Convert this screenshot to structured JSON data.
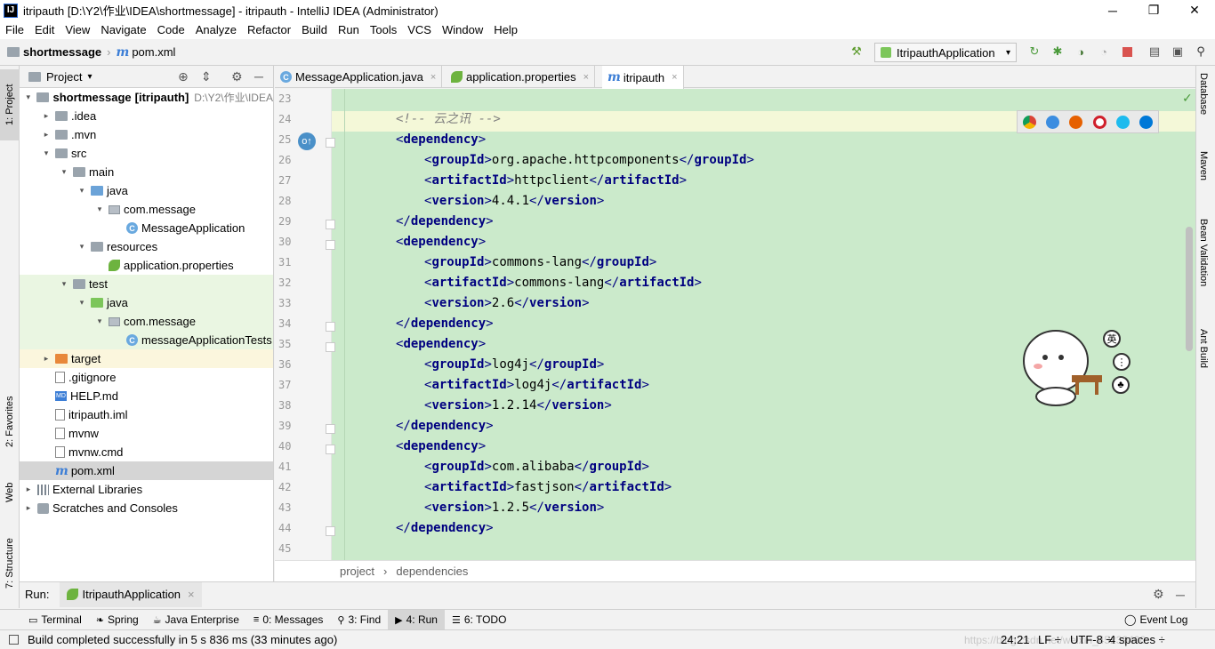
{
  "window": {
    "title": "itripauth [D:\\Y2\\作业\\IDEA\\shortmessage] - itripauth - IntelliJ IDEA (Administrator)",
    "app_icon_text": "IJ",
    "minimize": "─",
    "maximize": "❐",
    "close": "✕"
  },
  "menu": [
    "File",
    "Edit",
    "View",
    "Navigate",
    "Code",
    "Analyze",
    "Refactor",
    "Build",
    "Run",
    "Tools",
    "VCS",
    "Window",
    "Help"
  ],
  "navbar": {
    "project": "shortmessage",
    "sep": "›",
    "file": "pom.xml",
    "run_config": "ItripauthApplication"
  },
  "left_stripe": {
    "project": "1: Project",
    "favorites": "2: Favorites",
    "web": "Web",
    "structure": "7: Structure"
  },
  "project_panel": {
    "header": "Project",
    "header_arrow": "▾",
    "tree": [
      {
        "label": "shortmessage",
        "module": "[itripauth]",
        "path": "D:\\Y2\\作业\\IDEA"
      },
      {
        "label": ".idea"
      },
      {
        "label": ".mvn"
      },
      {
        "label": "src"
      },
      {
        "label": "main"
      },
      {
        "label": "java"
      },
      {
        "label": "com.message"
      },
      {
        "label": "MessageApplication"
      },
      {
        "label": "resources"
      },
      {
        "label": "application.properties"
      },
      {
        "label": "test"
      },
      {
        "label": "java"
      },
      {
        "label": "com.message"
      },
      {
        "label": "messageApplicationTests"
      },
      {
        "label": "target"
      },
      {
        "label": ".gitignore"
      },
      {
        "label": "HELP.md"
      },
      {
        "label": "itripauth.iml"
      },
      {
        "label": "mvnw"
      },
      {
        "label": "mvnw.cmd"
      },
      {
        "label": "pom.xml"
      },
      {
        "label": "External Libraries"
      },
      {
        "label": "Scratches and Consoles"
      }
    ]
  },
  "editor_tabs": [
    {
      "label": "MessageApplication.java",
      "close": "×"
    },
    {
      "label": "application.properties",
      "close": "×"
    },
    {
      "label": "itripauth",
      "close": "×"
    }
  ],
  "editor": {
    "line_numbers": [
      "23",
      "24",
      "25",
      "26",
      "27",
      "28",
      "29",
      "30",
      "31",
      "32",
      "33",
      "34",
      "35",
      "36",
      "37",
      "38",
      "39",
      "40",
      "41",
      "42",
      "43",
      "44",
      "45"
    ],
    "comment": "<!-- 云之讯 -->",
    "deps": [
      {
        "groupId": "org.apache.httpcomponents",
        "artifactId": "httpclient",
        "version": "4.4.1"
      },
      {
        "groupId": "commons-lang",
        "artifactId": "commons-lang",
        "version": "2.6"
      },
      {
        "groupId": "log4j",
        "artifactId": "log4j",
        "version": "1.2.14"
      },
      {
        "groupId": "com.alibaba",
        "artifactId": "fastjson",
        "version": "1.2.5"
      }
    ],
    "tag_dependency": "dependency",
    "tag_groupId": "groupId",
    "tag_artifactId": "artifactId",
    "tag_version": "version",
    "breadcrumb_project": "project",
    "breadcrumb_sep": "›",
    "breadcrumb_dependencies": "dependencies"
  },
  "right_stripe": [
    "Database",
    "Maven",
    "Bean Validation",
    "Ant Build"
  ],
  "run_bar": {
    "label": "Run:",
    "config": "ItripauthApplication",
    "close": "×"
  },
  "bottom_tabs": [
    {
      "icon": "terminal-icon",
      "label": "Terminal"
    },
    {
      "icon": "spring-icon",
      "label": "Spring"
    },
    {
      "icon": "java-enterprise-icon",
      "label": "Java Enterprise"
    },
    {
      "icon": "messages-icon",
      "label": "0: Messages"
    },
    {
      "icon": "find-icon",
      "label": "3: Find"
    },
    {
      "icon": "run-icon",
      "label": "4: Run"
    },
    {
      "icon": "todo-icon",
      "label": "6: TODO"
    }
  ],
  "event_log": "Event Log",
  "status": {
    "message": "Build completed successfully in 5 s 836 ms (33 minutes ago)",
    "position": "24:21",
    "line_sep": "LF ÷",
    "encoding": "UTF-8 ÷",
    "indent": "4 spaces ÷",
    "watermark": "https://blog.csdn.net/weixin_45239400"
  },
  "mascot": {
    "badge1": "英",
    "badge2": "⋮",
    "badge3": "♣"
  },
  "colors": {
    "accent": "#3c7ed6",
    "editor_bg": "#cbeacb",
    "tag": "#000080"
  }
}
